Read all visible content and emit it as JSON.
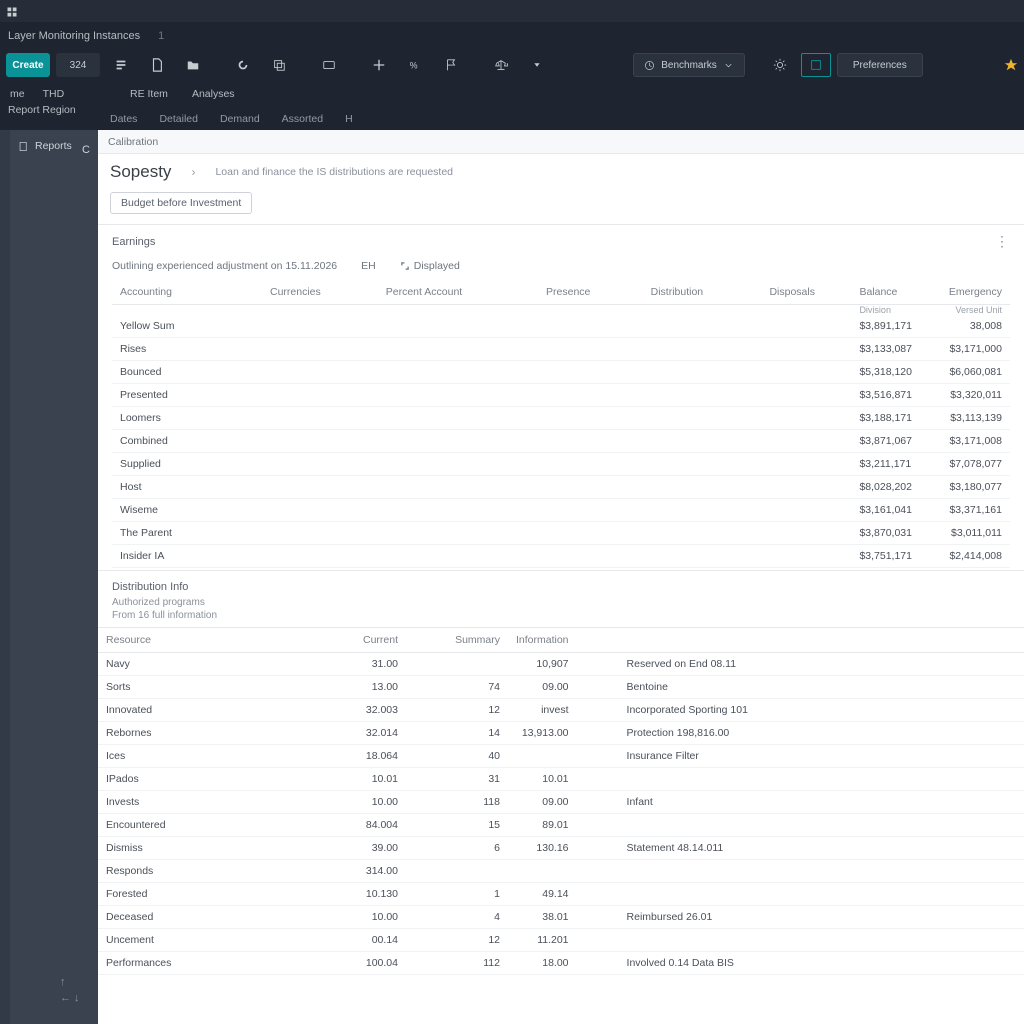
{
  "titlebar": {
    "app": ""
  },
  "crumbbar": {
    "text": "Layer Monitoring Instances",
    "count": "1"
  },
  "toolbar": {
    "create": "Create",
    "counter": "324",
    "dropdown": "Benchmarks",
    "secondary": "Preferences"
  },
  "subrow": {
    "left1": "me",
    "left2": "THD",
    "mid1": "RE Item",
    "mid2": "Analyses",
    "leftside": "Report Region"
  },
  "tabs": [
    "Dates",
    "Detailed",
    "Demand",
    "Assorted",
    "H"
  ],
  "side": {
    "item": "Reports",
    "ind": "C"
  },
  "main": {
    "crumb": "Calibration",
    "title": "Sopesty",
    "subtitle": "Loan and finance the IS distributions are requested",
    "chip": "Budget before Investment"
  },
  "panel1": {
    "title": "Earnings",
    "meta_text": "Outlining experienced adjustment on 15.11.2026",
    "meta_mid": "EH",
    "meta_action": "Displayed",
    "headers": [
      "Accounting",
      "Currencies",
      "Percent Account",
      "Presence",
      "Distribution",
      "Disposals",
      "",
      "Balance",
      "Division",
      "Versed Unit",
      "Emergency"
    ],
    "rows": [
      {
        "c1": "Yellow Sum",
        "c6": "$3,891,171",
        "c8": "38,008"
      },
      {
        "c1": "Rises",
        "c6": "$3,133,087",
        "c8": "$3,171,000"
      },
      {
        "c1": "Bounced",
        "c6": "$5,318,120",
        "c8": "$6,060,081"
      },
      {
        "c1": "Presented",
        "c6": "$3,516,871",
        "c8": "$3,320,011"
      },
      {
        "c1": "Loomers",
        "c6": "$3,188,171",
        "c8": "$3,113,139"
      },
      {
        "c1": "Combined",
        "c6": "$3,871,067",
        "c8": "$3,171,008"
      },
      {
        "c1": "Supplied",
        "c6": "$3,211,171",
        "c8": "$7,078,077"
      },
      {
        "c1": "Host",
        "c6": "$8,028,202",
        "c8": "$3,180,077"
      },
      {
        "c1": "Wiseme",
        "c6": "$3,161,041",
        "c8": "$3,371,161"
      },
      {
        "c1": "The Parent",
        "c6": "$3,870,031",
        "c8": "$3,011,011"
      },
      {
        "c1": "Insider IA",
        "c6": "$3,751,171",
        "c8": "$2,414,008"
      }
    ]
  },
  "panel2": {
    "title": "Distribution Info",
    "sub1": "Authorized programs",
    "sub2": "From 16  full information",
    "headers": [
      "Resource",
      "Current",
      "Summary",
      "Information",
      ""
    ],
    "rows": [
      {
        "c1": "Navy",
        "c2": "31.00",
        "c3": "",
        "c4": "10,907",
        "c5": "Reserved on End 08.11"
      },
      {
        "c1": "Sorts",
        "c2": "13.00",
        "c3": "74",
        "c4": "09.00",
        "c5": "Bentoine"
      },
      {
        "c1": "Innovated",
        "c2": "32.003",
        "c3": "12",
        "c4": "invest",
        "c5": "Incorporated Sporting 101"
      },
      {
        "c1": "Rebornes",
        "c2": "32.014",
        "c3": "14",
        "c4": "13,913.00",
        "c5": "Protection 198,816.00"
      },
      {
        "c1": "Ices",
        "c2": "18.064",
        "c3": "40",
        "c4": "",
        "c5": "Insurance Filter"
      },
      {
        "c1": "IPados",
        "c2": "10.01",
        "c3": "31",
        "c4": "10.01",
        "c5": ""
      },
      {
        "c1": "Invests",
        "c2": "10.00",
        "c3": "118",
        "c4": "09.00",
        "c5": "Infant"
      },
      {
        "c1": "Encountered",
        "c2": "84.004",
        "c3": "15",
        "c4": "89.01",
        "c5": ""
      },
      {
        "c1": "Dismiss",
        "c2": "39.00",
        "c3": "6",
        "c4": "130.16",
        "c5": "Statement 48.14.011"
      },
      {
        "c1": "Responds",
        "c2": "314.00",
        "c3": "",
        "c4": "",
        "c5": ""
      },
      {
        "c1": "Forested",
        "c2": "10.130",
        "c3": "1",
        "c4": "49.14",
        "c5": ""
      },
      {
        "c1": "Deceased",
        "c2": "10.00",
        "c3": "4",
        "c4": "38.01",
        "c5": "Reimbursed 26.01"
      },
      {
        "c1": "Uncement",
        "c2": "00.14",
        "c3": "12",
        "c4": "11.201",
        "c5": ""
      },
      {
        "c1": "Performances",
        "c2": "100.04",
        "c3": "112",
        "c4": "18.00",
        "c5": "Involved 0.14 Data BIS"
      }
    ]
  }
}
